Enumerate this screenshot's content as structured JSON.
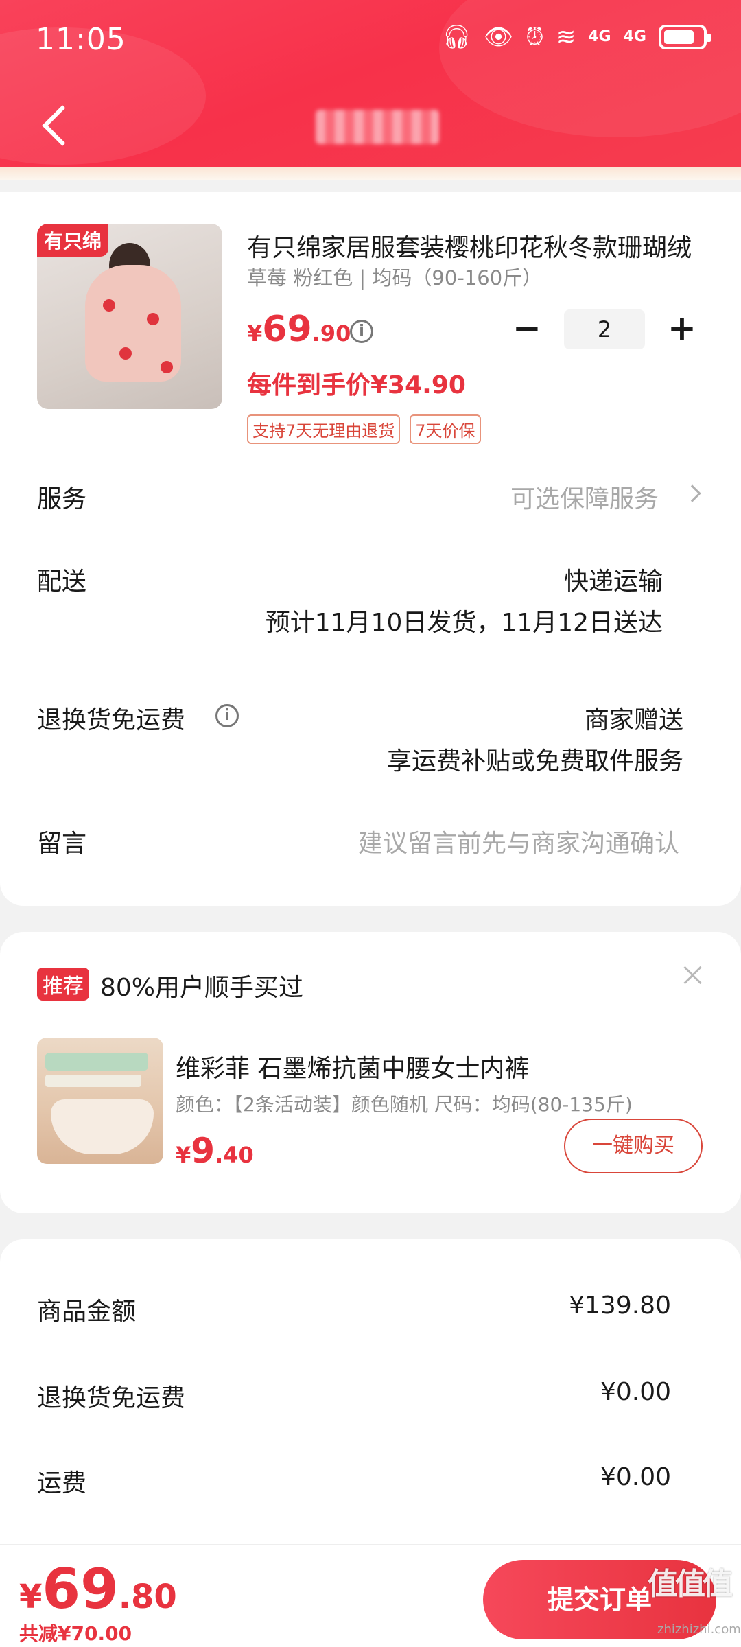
{
  "status_bar": {
    "time": "11:05",
    "icons": [
      "headphones-icon",
      "eye-icon",
      "alarm-icon",
      "wifi-icon",
      "signal-4g-icon",
      "signal-4g-icon",
      "battery-icon"
    ],
    "net1": "4G",
    "net2": "4G"
  },
  "colors": {
    "brand_red": "#e8333f",
    "header_red": "#f7314a",
    "gray_text": "#8a8a8a"
  },
  "product": {
    "shop_tag": "有只绵",
    "title": "有只绵家居服套装樱桃印花秋冬款珊瑚绒",
    "spec": "草莓 粉红色 | 均码（90-160斤）",
    "price_yen": "¥",
    "price_int": "69",
    "price_dec": ".90",
    "per_price": "每件到手价¥34.90",
    "quantity": "2",
    "minus": "−",
    "plus": "+",
    "badges": [
      "支持7天无理由退货",
      "7天价保"
    ]
  },
  "rows": {
    "service_label": "服务",
    "service_value": "可选保障服务",
    "delivery_label": "配送",
    "delivery_value": "快递运输",
    "delivery_sub": "预计11月10日发货，11月12日送达",
    "return_label": "退换货免运费",
    "return_value": "商家赠送",
    "return_sub": "享运费补贴或免费取件服务",
    "message_label": "留言",
    "message_placeholder": "建议留言前先与商家沟通确认"
  },
  "recommend": {
    "tag": "推荐",
    "title": "80%用户顺手买过",
    "name": "维彩菲 石墨烯抗菌中腰女士内裤",
    "spec": "颜色：【2条活动装】颜色随机   尺码：均码(80-135斤)",
    "price_yen": "¥",
    "price_int": "9",
    "price_dec": ".40",
    "buy_label": "一键购买"
  },
  "summary": [
    {
      "label": "商品金额",
      "value": "¥139.80"
    },
    {
      "label": "退换货免运费",
      "value": "¥0.00"
    },
    {
      "label": "运费",
      "value": "¥0.00"
    }
  ],
  "bottom": {
    "total_yen": "¥",
    "total_int": "69",
    "total_dec": ".80",
    "discount": "共减¥70.00",
    "submit_label": "提交订单",
    "watermark": "值值值",
    "watermark_sub": "zhizhizhi.com"
  }
}
